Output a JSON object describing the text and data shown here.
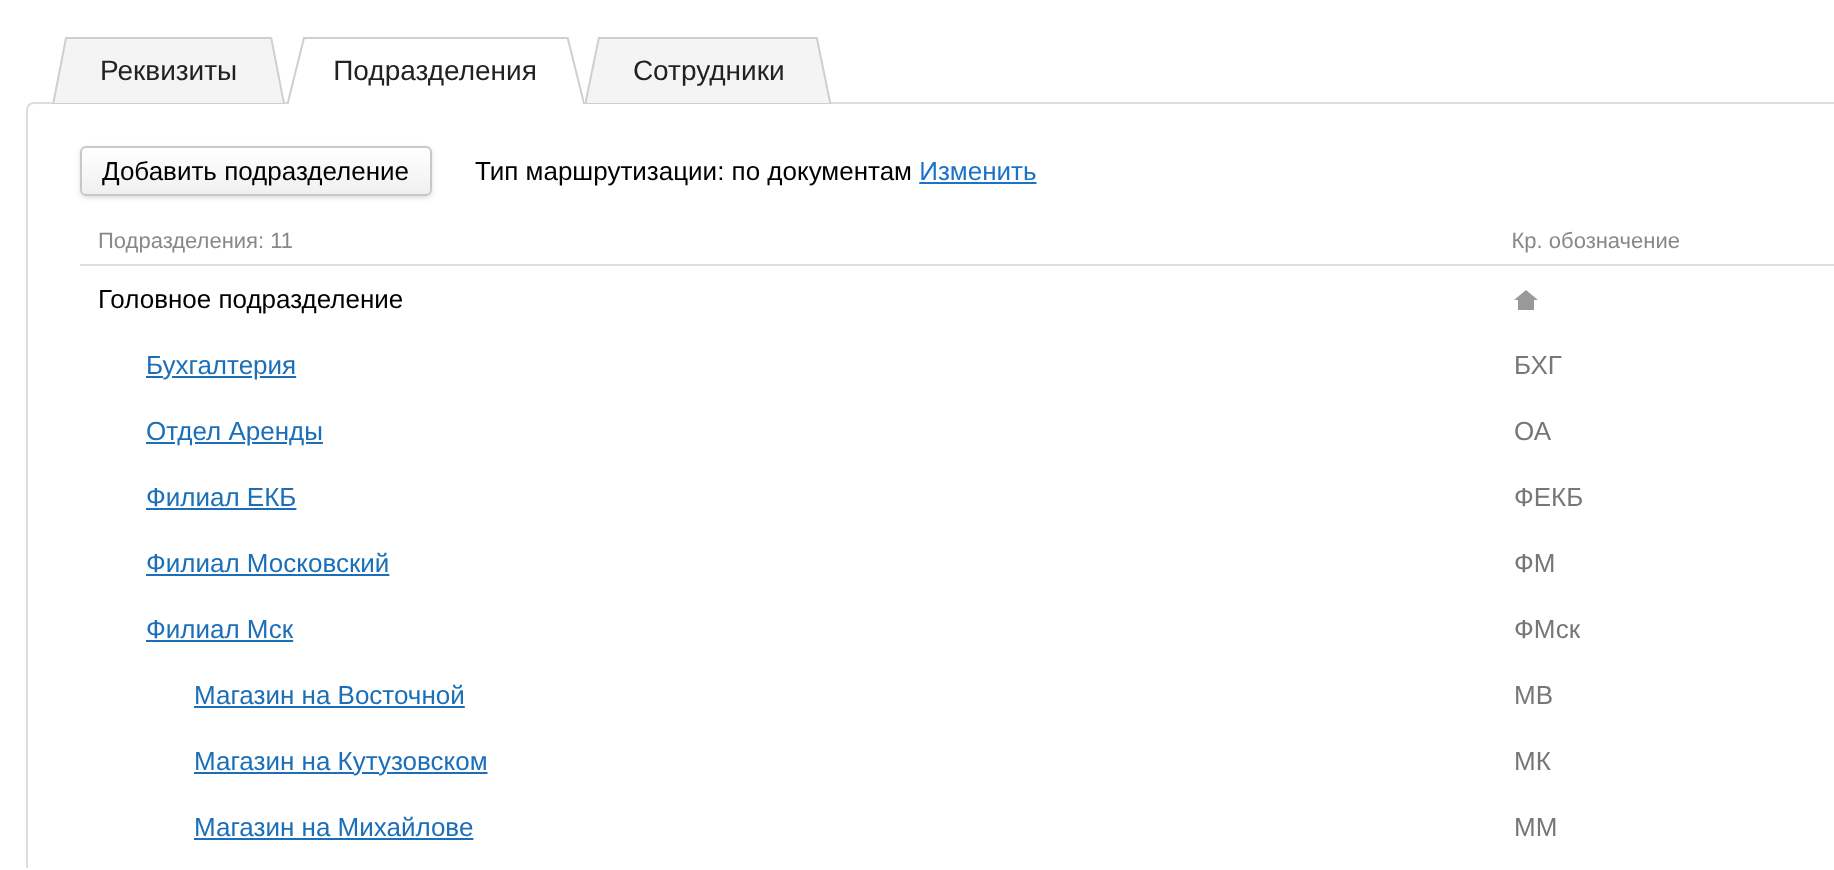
{
  "tabs": [
    {
      "label": "Реквизиты",
      "selected": false
    },
    {
      "label": "Подразделения",
      "selected": true
    },
    {
      "label": "Сотрудники",
      "selected": false
    }
  ],
  "add_button": "Добавить подразделение",
  "routing": {
    "label": "Тип маршрутизации: по документам",
    "link": "Изменить"
  },
  "table": {
    "columns": [
      "Подразделения: 11",
      "Кр. обозначение"
    ],
    "rows": [
      {
        "kind": "head",
        "name": "Головное подразделение",
        "children": [
          {
            "kind": "unit",
            "name": "Бухгалтерия",
            "code": "БХГ"
          },
          {
            "kind": "unit",
            "name": "Отдел Аренды",
            "code": "ОА"
          },
          {
            "kind": "unit",
            "name": "Филиал ЕКБ",
            "code": "ФЕКБ"
          },
          {
            "kind": "unit",
            "name": "Филиал Московский",
            "code": "ФМ"
          },
          {
            "kind": "unit",
            "name": "Филиал Мск",
            "code": "ФМск",
            "children": [
              {
                "kind": "unit",
                "name": "Магазин на Восточной",
                "code": "МВ"
              },
              {
                "kind": "unit",
                "name": "Магазин на Кутузовском",
                "code": "МК"
              },
              {
                "kind": "unit",
                "name": "Магазин на Михайлове",
                "code": "ММ"
              }
            ]
          }
        ]
      }
    ]
  }
}
